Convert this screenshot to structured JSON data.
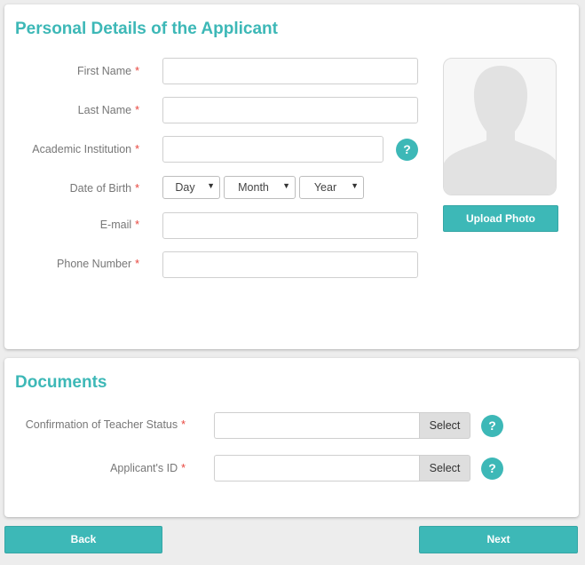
{
  "personal": {
    "title": "Personal Details of the Applicant",
    "required_mark": "*",
    "fields": {
      "first_name": {
        "label": "First Name",
        "value": ""
      },
      "last_name": {
        "label": "Last Name",
        "value": ""
      },
      "academic_institution": {
        "label": "Academic Institution",
        "value": ""
      },
      "date_of_birth": {
        "label": "Date of Birth",
        "day": "Day",
        "month": "Month",
        "year": "Year"
      },
      "email": {
        "label": "E-mail",
        "value": ""
      },
      "phone_number": {
        "label": "Phone Number",
        "value": ""
      }
    },
    "help_icon": "?",
    "upload_photo_label": "Upload Photo"
  },
  "documents": {
    "title": "Documents",
    "required_mark": "*",
    "select_label": "Select",
    "help_icon": "?",
    "items": [
      {
        "label": "Confirmation of Teacher Status"
      },
      {
        "label": "Applicant's ID"
      }
    ]
  },
  "nav": {
    "back_label": "Back",
    "next_label": "Next"
  },
  "colors": {
    "accent": "#3db8b7",
    "required": "#e8463e",
    "background": "#ededed"
  },
  "icons": {
    "help": "question-mark-icon",
    "dropdown": "caret-down-icon",
    "photo_placeholder": "person-silhouette-icon"
  }
}
